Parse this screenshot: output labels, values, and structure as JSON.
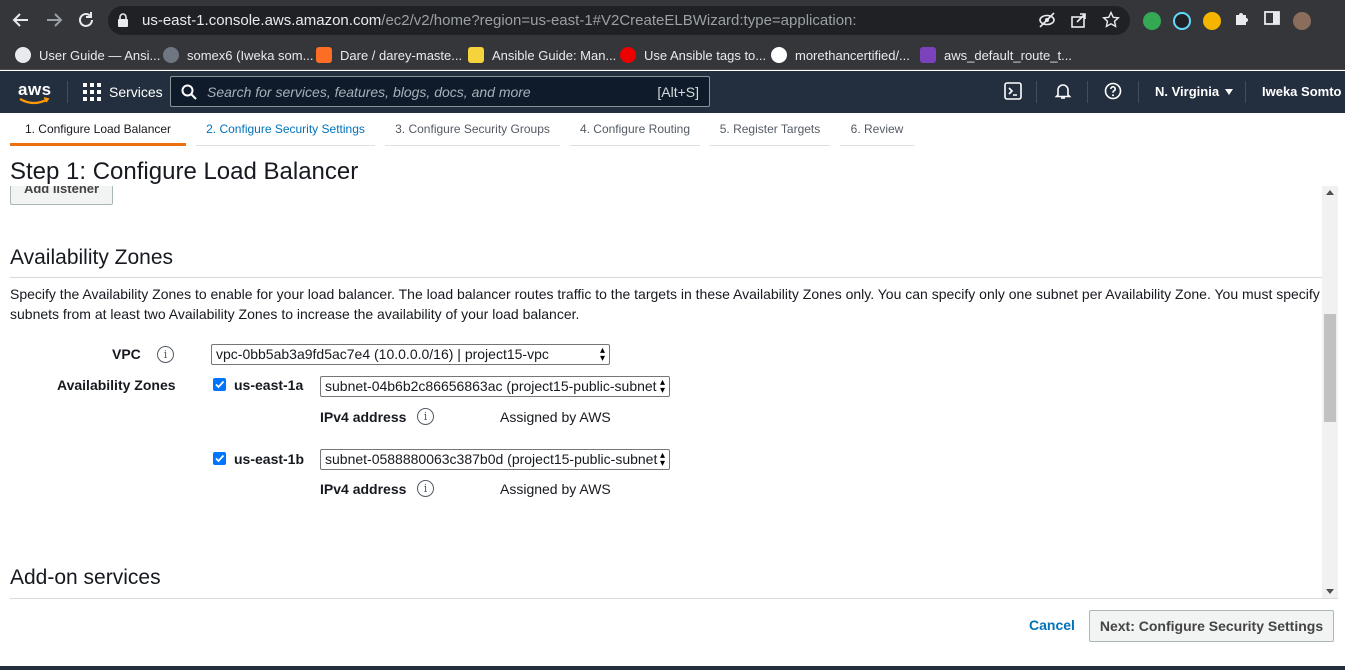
{
  "browser": {
    "url_host": "us-east-1.console.aws.amazon.com",
    "url_path": "/ec2/v2/home?region=us-east-1#V2CreateELBWizard:type=application:"
  },
  "bookmarks": [
    {
      "label": "User Guide — Ansi...",
      "color": "#e8eaed"
    },
    {
      "label": "somex6 (Iweka som...",
      "color": "#6e7681"
    },
    {
      "label": "Dare / darey-maste...",
      "color": "#fc6d26"
    },
    {
      "label": "Ansible Guide: Man...",
      "color": "#f5d33c"
    },
    {
      "label": "Use Ansible tags to...",
      "color": "#ee0000"
    },
    {
      "label": "morethancertified/...",
      "color": "#ffffff"
    },
    {
      "label": "aws_default_route_t...",
      "color": "#7b42bc"
    }
  ],
  "aws_nav": {
    "logo": "aws",
    "services": "Services",
    "search_placeholder": "Search for services, features, blogs, docs, and more",
    "search_shortcut": "[Alt+S]",
    "region": "N. Virginia",
    "user": "Iweka Somto"
  },
  "tabs": [
    {
      "label": "1. Configure Load Balancer",
      "state": "active"
    },
    {
      "label": "2. Configure Security Settings",
      "state": "link"
    },
    {
      "label": "3. Configure Security Groups",
      "state": "default"
    },
    {
      "label": "4. Configure Routing",
      "state": "default"
    },
    {
      "label": "5. Register Targets",
      "state": "default"
    },
    {
      "label": "6. Review",
      "state": "default"
    }
  ],
  "page": {
    "step_title": "Step 1: Configure Load Balancer",
    "add_listener": "Add listener"
  },
  "availability": {
    "title": "Availability Zones",
    "description": "Specify the Availability Zones to enable for your load balancer. The load balancer routes traffic to the targets in these Availability Zones only. You can specify only one subnet per Availability Zone. You must specify subnets from at least two Availability Zones to increase the availability of your load balancer.",
    "vpc_label": "VPC",
    "vpc_value": "vpc-0bb5ab3a9fd5ac7e4 (10.0.0.0/16) | project15-vpc",
    "zones_label": "Availability Zones",
    "zones": [
      {
        "name": "us-east-1a",
        "checked": true,
        "subnet": "subnet-04b6b2c86656863ac (project15-public-subnet",
        "ipv4_label": "IPv4 address",
        "ipv4_value": "Assigned by AWS"
      },
      {
        "name": "us-east-1b",
        "checked": true,
        "subnet": "subnet-0588880063c387b0d (project15-public-subnet",
        "ipv4_label": "IPv4 address",
        "ipv4_value": "Assigned by AWS"
      }
    ]
  },
  "addon": {
    "title": "Add-on services"
  },
  "footer": {
    "cancel": "Cancel",
    "next": "Next: Configure Security Settings"
  }
}
